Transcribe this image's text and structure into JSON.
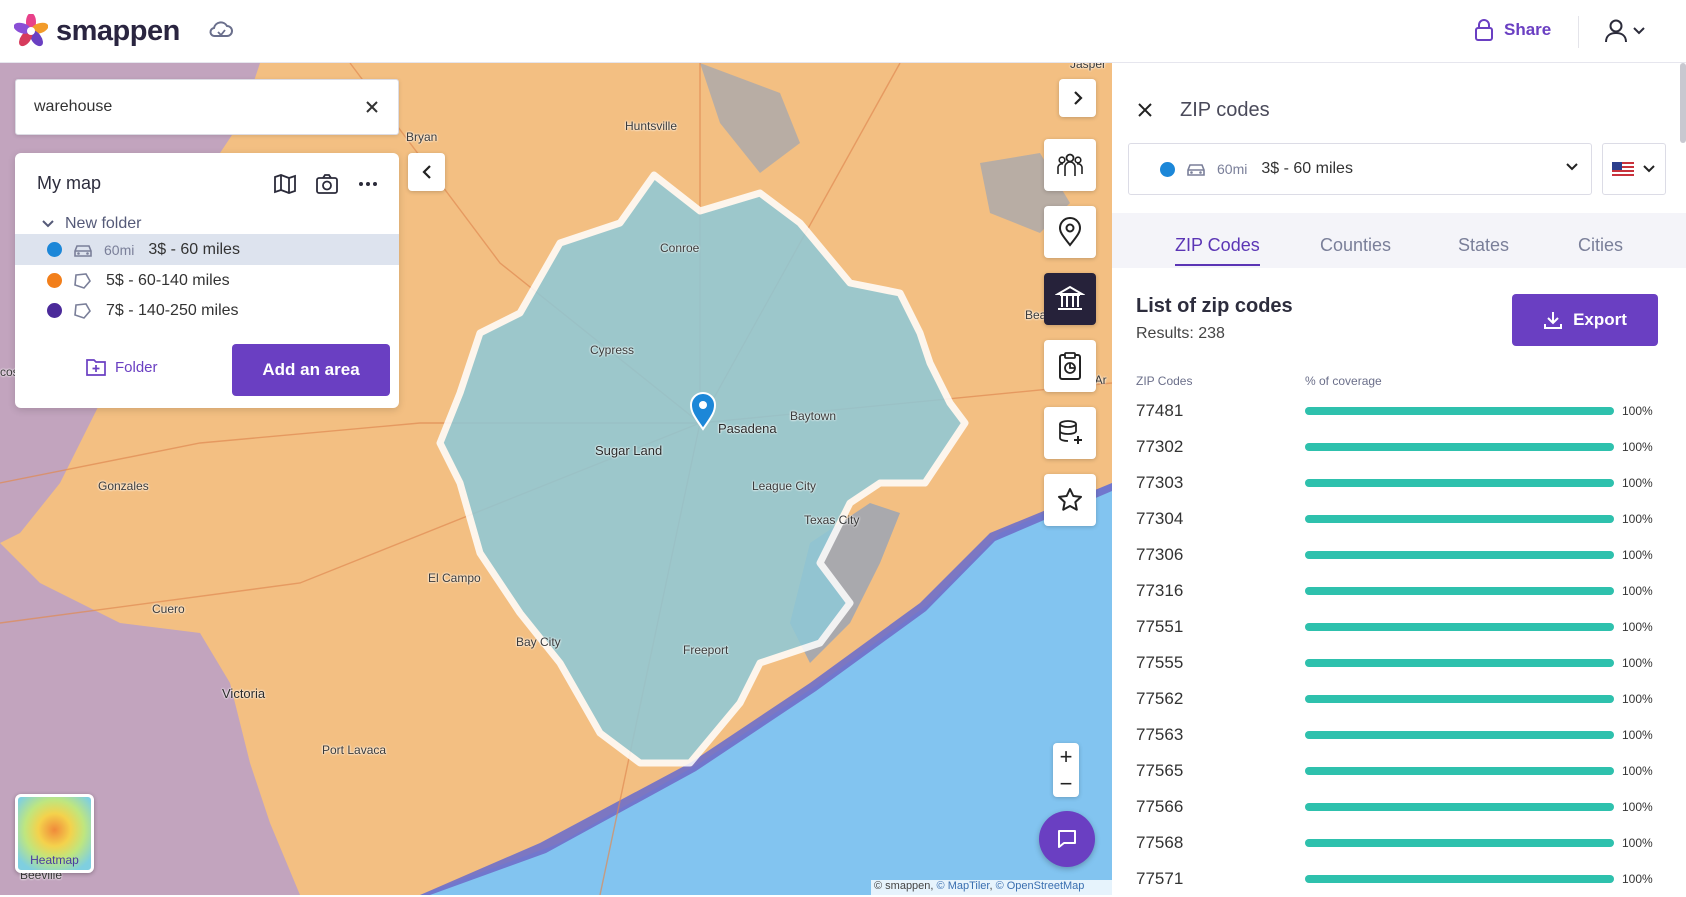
{
  "header": {
    "brand": "smappen",
    "share_label": "Share",
    "icons": [
      "flower-logo-icon",
      "cloud-sync-icon",
      "lock-icon",
      "user-icon",
      "chevron-down-icon"
    ]
  },
  "search": {
    "value": "warehouse",
    "placeholder": ""
  },
  "my_map": {
    "title": "My map",
    "folder_label": "New folder",
    "areas": [
      {
        "color": "#1c87d8",
        "icon": "car-icon",
        "distance": "60mi",
        "name": "3$ - 60 miles",
        "selected": true
      },
      {
        "color": "#f27f1b",
        "icon": "polygon-icon",
        "distance": "",
        "name": "5$ - 60-140 miles",
        "selected": false
      },
      {
        "color": "#4b2a9a",
        "icon": "polygon-icon",
        "distance": "",
        "name": "7$ - 140-250 miles",
        "selected": false
      }
    ],
    "folder_button": "Folder",
    "add_area_button": "Add an area"
  },
  "map": {
    "labels": [
      {
        "text": "Bryan",
        "cls": ""
      },
      {
        "text": "Huntsville",
        "cls": ""
      },
      {
        "text": "Jasper",
        "cls": ""
      },
      {
        "text": "Conroe",
        "cls": ""
      },
      {
        "text": "Cypress",
        "cls": ""
      },
      {
        "text": "Beaumont",
        "cls": ""
      },
      {
        "text": "Port Ar",
        "cls": ""
      },
      {
        "text": "Baytown",
        "cls": ""
      },
      {
        "text": "Pasadena",
        "cls": "big"
      },
      {
        "text": "Sugar Land",
        "cls": "big"
      },
      {
        "text": "League City",
        "cls": ""
      },
      {
        "text": "Texas City",
        "cls": ""
      },
      {
        "text": "Gonzales",
        "cls": ""
      },
      {
        "text": "El Campo",
        "cls": ""
      },
      {
        "text": "Cuero",
        "cls": ""
      },
      {
        "text": "Bay City",
        "cls": ""
      },
      {
        "text": "Freeport",
        "cls": ""
      },
      {
        "text": "Victoria",
        "cls": "big"
      },
      {
        "text": "Port Lavaca",
        "cls": ""
      },
      {
        "text": "Beeville",
        "cls": ""
      },
      {
        "text": "cos",
        "cls": ""
      }
    ],
    "heatmap_label": "Heatmap",
    "zoom_in": "+",
    "zoom_out": "−",
    "attribution": {
      "prefix": "© smappen, ",
      "maptiler": "© MapTiler",
      "sep": ", ",
      "osm": "© OpenStreetMap"
    }
  },
  "toolbar_icons": [
    "population-icon",
    "location-pin-icon",
    "institution-icon",
    "report-icon",
    "database-add-icon",
    "star-icon"
  ],
  "panel": {
    "title": "ZIP codes",
    "selected_area": {
      "distance": "60mi",
      "name": "3$ - 60 miles",
      "color": "#1c87d8"
    },
    "country_flag": "us-flag-icon",
    "tabs": [
      "ZIP Codes",
      "Counties",
      "States",
      "Cities"
    ],
    "active_tab": "ZIP Codes",
    "list_title": "List of zip codes",
    "results": "Results: 238",
    "export_label": "Export",
    "col_zip": "ZIP Codes",
    "col_coverage": "% of coverage",
    "rows": [
      {
        "zip": "77481",
        "coverage": "100%",
        "fraction": 1
      },
      {
        "zip": "77302",
        "coverage": "100%",
        "fraction": 1
      },
      {
        "zip": "77303",
        "coverage": "100%",
        "fraction": 1
      },
      {
        "zip": "77304",
        "coverage": "100%",
        "fraction": 1
      },
      {
        "zip": "77306",
        "coverage": "100%",
        "fraction": 1
      },
      {
        "zip": "77316",
        "coverage": "100%",
        "fraction": 1
      },
      {
        "zip": "77551",
        "coverage": "100%",
        "fraction": 1
      },
      {
        "zip": "77555",
        "coverage": "100%",
        "fraction": 1
      },
      {
        "zip": "77562",
        "coverage": "100%",
        "fraction": 1
      },
      {
        "zip": "77563",
        "coverage": "100%",
        "fraction": 1
      },
      {
        "zip": "77565",
        "coverage": "100%",
        "fraction": 1
      },
      {
        "zip": "77566",
        "coverage": "100%",
        "fraction": 1
      },
      {
        "zip": "77568",
        "coverage": "100%",
        "fraction": 1
      },
      {
        "zip": "77571",
        "coverage": "100%",
        "fraction": 1
      }
    ]
  },
  "colors": {
    "accent": "#6a3fc2",
    "bar": "#2ec1ad",
    "area_fill": "#8ec9d8",
    "map_base": "#f3bf82",
    "sea": "#82c4f0"
  }
}
